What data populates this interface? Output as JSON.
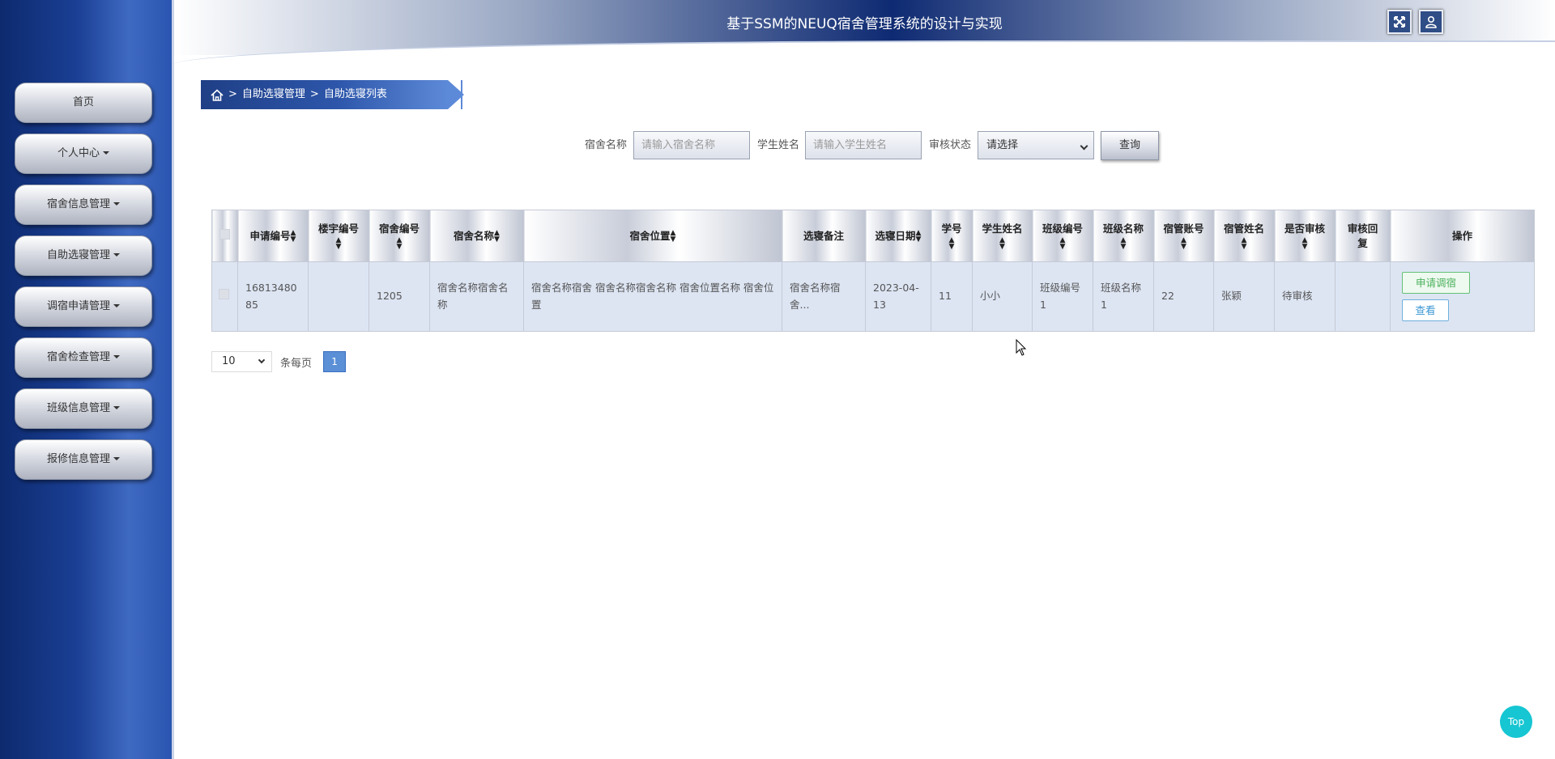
{
  "header": {
    "title": "基于SSM的NEUQ宿舍管理系统的设计与实现"
  },
  "sidebar": {
    "items": [
      {
        "label": "首页",
        "dropdown": false
      },
      {
        "label": "个人中心",
        "dropdown": true
      },
      {
        "label": "宿舍信息管理",
        "dropdown": true
      },
      {
        "label": "自助选寝管理",
        "dropdown": true
      },
      {
        "label": "调宿申请管理",
        "dropdown": true
      },
      {
        "label": "宿舍检查管理",
        "dropdown": true
      },
      {
        "label": "班级信息管理",
        "dropdown": true
      },
      {
        "label": "报修信息管理",
        "dropdown": true
      }
    ]
  },
  "breadcrumb": {
    "items": [
      "自助选寝管理",
      "自助选寝列表"
    ],
    "separator": ">"
  },
  "search": {
    "dorm_name_label": "宿舍名称",
    "dorm_name_placeholder": "请输入宿舍名称",
    "student_name_label": "学生姓名",
    "student_name_placeholder": "请输入学生姓名",
    "status_label": "审核状态",
    "status_value": "请选择",
    "query_label": "查询"
  },
  "table": {
    "columns": [
      "申请编号",
      "楼宇编号",
      "宿舍编号",
      "宿舍名称",
      "宿舍位置",
      "选寝备注",
      "选寝日期",
      "学号",
      "学生姓名",
      "班级编号",
      "班级名称",
      "宿管账号",
      "宿管姓名",
      "是否审核",
      "审核回复",
      "操作"
    ],
    "rows": [
      {
        "cells": [
          "1681348085",
          "",
          "1205",
          "宿舍名称宿舍名称",
          "宿舍名称宿舍 宿舍名称宿舍名称 宿舍位置名称 宿舍位置",
          "宿舍名称宿舍...",
          "2023-04-13",
          "11",
          "小小",
          "班级编号1",
          "班级名称1",
          "22",
          "张颖",
          "待审核",
          ""
        ],
        "actions": [
          "申请调宿",
          "查看"
        ]
      }
    ]
  },
  "pagination": {
    "page_size": "10",
    "page_size_label": "条每页",
    "current_page": "1"
  },
  "top_button": "Top",
  "colors": {
    "sidebar": "#1a3f94",
    "header_center": "#0e2a72",
    "row_bg": "#dde5f3",
    "page_active": "#5b8fd6",
    "top_btn": "#16c6d2"
  }
}
